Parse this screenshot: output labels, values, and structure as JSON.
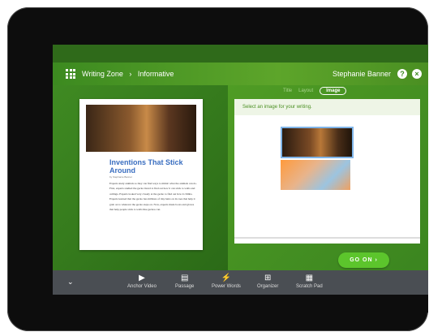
{
  "header": {
    "breadcrumb_root": "Writing Zone",
    "breadcrumb_current": "Informative",
    "user_name": "Stephanie Banner",
    "help_label": "?",
    "close_label": "×"
  },
  "article": {
    "title": "Inventions That Stick Around",
    "byline": "by Stephanie Banner",
    "body": "Experts study animals so they can find ways to mimic what the animals can do. First, experts studied the gecko lizard to find out how it can stick to walls and ceilings. Experts looked very closely at the gecko to find out how it climbs. Experts learned that the gecko has millions of tiny hairs on its toes that help it grab on to whatever the gecko steps on. Now, experts made boots and gloves that help people stick to walls like geckos can."
  },
  "right_panel": {
    "tabs": [
      "Title",
      "Layout",
      "Image"
    ],
    "active_tab": "Image",
    "instruction": "Select an image for your writing."
  },
  "go_on_label": "GO ON ›",
  "toolbar": {
    "items": [
      {
        "label": "Anchor Video",
        "icon": "video-icon"
      },
      {
        "label": "Passage",
        "icon": "document-icon"
      },
      {
        "label": "Power Words",
        "icon": "power-words-icon"
      },
      {
        "label": "Organizer",
        "icon": "organizer-icon"
      },
      {
        "label": "Scratch Pad",
        "icon": "notepad-icon"
      }
    ]
  },
  "colors": {
    "green_dark": "#2f6a1a",
    "green_header": "#4a9a24",
    "go_on": "#5cc52c",
    "title_blue": "#3a6ec0",
    "toolbar_bg": "#4a4e53"
  }
}
